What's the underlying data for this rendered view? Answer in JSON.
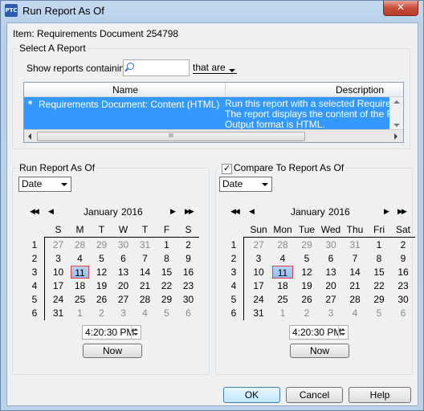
{
  "window": {
    "title": "Run Report As Of",
    "logo_text": "PTC",
    "close_glyph": "✕"
  },
  "item_label": "Item: Requirements Document 254798",
  "select_report": {
    "legend": "Select A Report",
    "filter_label": "Show reports containing",
    "search_value": "",
    "filter_mode": "that are",
    "columns": [
      "Name",
      "Description"
    ],
    "rows": [
      {
        "star": "*",
        "name": "Requirements Document: Content (HTML)",
        "description_lines": [
          "Run this report with a selected Requirement",
          "The report displays the content of the Requ",
          "Output format is HTML."
        ]
      }
    ],
    "scroll_thumb_glyph": "III"
  },
  "run_as_of": {
    "legend": "Run Report As Of",
    "mode": "Date",
    "month": "January",
    "year": "2016",
    "time": "4:20:30 PM",
    "now_label": "Now",
    "weekday_headers": [
      "S",
      "M",
      "T",
      "W",
      "T",
      "F",
      "S"
    ]
  },
  "compare_as_of": {
    "legend": "Compare To Report As Of",
    "checked": true,
    "check_glyph": "✓",
    "mode": "Date",
    "month": "January",
    "year": "2016",
    "time": "4:20:30 PM",
    "now_label": "Now",
    "weekday_headers": [
      "Sun",
      "Mon",
      "Tue",
      "Wed",
      "Thu",
      "Fri",
      "Sat"
    ]
  },
  "calendar": {
    "week_numbers": [
      "1",
      "2",
      "3",
      "4",
      "5",
      "6"
    ],
    "weeks": [
      [
        "27",
        "28",
        "29",
        "30",
        "31",
        "1",
        "2"
      ],
      [
        "3",
        "4",
        "5",
        "6",
        "7",
        "8",
        "9"
      ],
      [
        "10",
        "11",
        "12",
        "13",
        "14",
        "15",
        "16"
      ],
      [
        "17",
        "18",
        "19",
        "20",
        "21",
        "22",
        "23"
      ],
      [
        "24",
        "25",
        "26",
        "27",
        "28",
        "29",
        "30"
      ],
      [
        "31",
        "1",
        "2",
        "3",
        "4",
        "5",
        "6"
      ]
    ],
    "selected_day": "11",
    "nav_first": "◀◀",
    "nav_prev": "◀",
    "nav_next": "▶",
    "nav_last": "▶▶"
  },
  "buttons": {
    "ok": "OK",
    "cancel": "Cancel",
    "help": "Help"
  },
  "colors": {
    "selection": "#3399ff",
    "today_border": "#e04040"
  }
}
